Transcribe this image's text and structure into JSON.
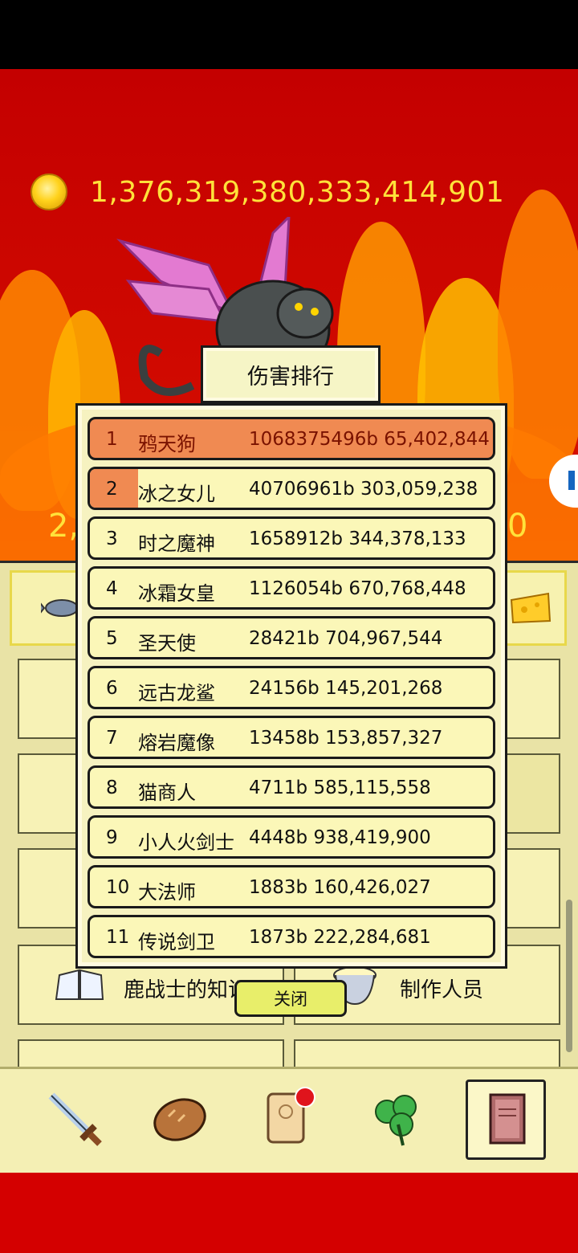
{
  "hud": {
    "gold_amount": "1,376,319,380,333,414,901",
    "side_left_fragment": "2,",
    "side_right_fragment": "0"
  },
  "leaderboard": {
    "title": "伤害排行",
    "rows": [
      {
        "rank": "1",
        "name": "鸦天狗",
        "value": "1068375496b 65,402,844",
        "progress": 1.0
      },
      {
        "rank": "2",
        "name": "冰之女儿",
        "value": "40706961b 303,059,238",
        "progress": 0.04
      },
      {
        "rank": "3",
        "name": "时之魔神",
        "value": "1658912b 344,378,133",
        "progress": 0
      },
      {
        "rank": "4",
        "name": "冰霜女皇",
        "value": "1126054b 670,768,448",
        "progress": 0
      },
      {
        "rank": "5",
        "name": "圣天使",
        "value": "28421b 704,967,544",
        "progress": 0
      },
      {
        "rank": "6",
        "name": "远古龙鲨",
        "value": "24156b 145,201,268",
        "progress": 0
      },
      {
        "rank": "7",
        "name": "熔岩魔像",
        "value": "13458b 153,857,327",
        "progress": 0
      },
      {
        "rank": "8",
        "name": "猫商人",
        "value": "4711b 585,115,558",
        "progress": 0
      },
      {
        "rank": "9",
        "name": "小人火剑士",
        "value": "4448b 938,419,900",
        "progress": 0
      },
      {
        "rank": "10",
        "name": "大法师",
        "value": "1883b 160,426,027",
        "progress": 0
      },
      {
        "rank": "11",
        "name": "传说剑卫",
        "value": "1873b 222,284,681",
        "progress": 0
      }
    ],
    "close_label": "关闭"
  },
  "menu": {
    "knowledge_label": "鹿战士的知识",
    "credits_label": "制作人员"
  },
  "bottom_nav": [
    {
      "icon": "sword-icon",
      "active": false
    },
    {
      "icon": "bread-icon",
      "active": false
    },
    {
      "icon": "scroll-icon",
      "active": false,
      "badge": true
    },
    {
      "icon": "clover-icon",
      "active": false
    },
    {
      "icon": "book-icon",
      "active": true
    }
  ],
  "colors": {
    "gold_text": "#ffe23a",
    "first_row": "#f08a52",
    "panel": "#f6f2c0",
    "footer_red": "#d40000"
  }
}
